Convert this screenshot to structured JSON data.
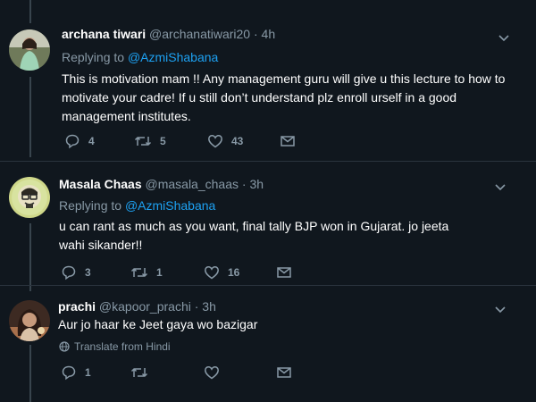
{
  "colors": {
    "background": "#10171e",
    "text_primary": "#ffffff",
    "text_secondary": "#8899a6",
    "link": "#1da1f2",
    "thread_line": "#38444d"
  },
  "tweets": [
    {
      "name": "archana tiwari",
      "handle": "@archanatiwari20",
      "time": "· 4h",
      "replying_prefix": "Replying to",
      "replying_to": "@AzmiShabana",
      "text": "This is motivation mam !! Any management guru will give u this lecture to how to motivate your cadre! If u still don’t understand plz enroll urself in a good management institutes.",
      "replies": "4",
      "retweets": "5",
      "likes": "43",
      "icons": [
        "reply-icon",
        "retweet-icon",
        "like-icon",
        "direct-message-icon",
        "chevron-down-icon"
      ]
    },
    {
      "name": "Masala Chaas",
      "handle": "@masala_chaas",
      "time": "· 3h",
      "replying_prefix": "Replying to",
      "replying_to": "@AzmiShabana",
      "text": "u can rant as much as you want, final tally BJP won in Gujarat. jo jeeta wahi sikander!!",
      "replies": "3",
      "retweets": "1",
      "likes": "16",
      "icons": [
        "reply-icon",
        "retweet-icon",
        "like-icon",
        "direct-message-icon",
        "chevron-down-icon"
      ]
    },
    {
      "name": "prachi",
      "handle": "@kapoor_prachi",
      "time": "· 3h",
      "text": "Aur jo haar ke Jeet gaya wo bazigar",
      "translate": "Translate from Hindi",
      "replies": "1",
      "retweets": "",
      "likes": "",
      "icons": [
        "globe-icon",
        "reply-icon",
        "retweet-icon",
        "like-icon",
        "direct-message-icon",
        "chevron-down-icon"
      ]
    }
  ]
}
